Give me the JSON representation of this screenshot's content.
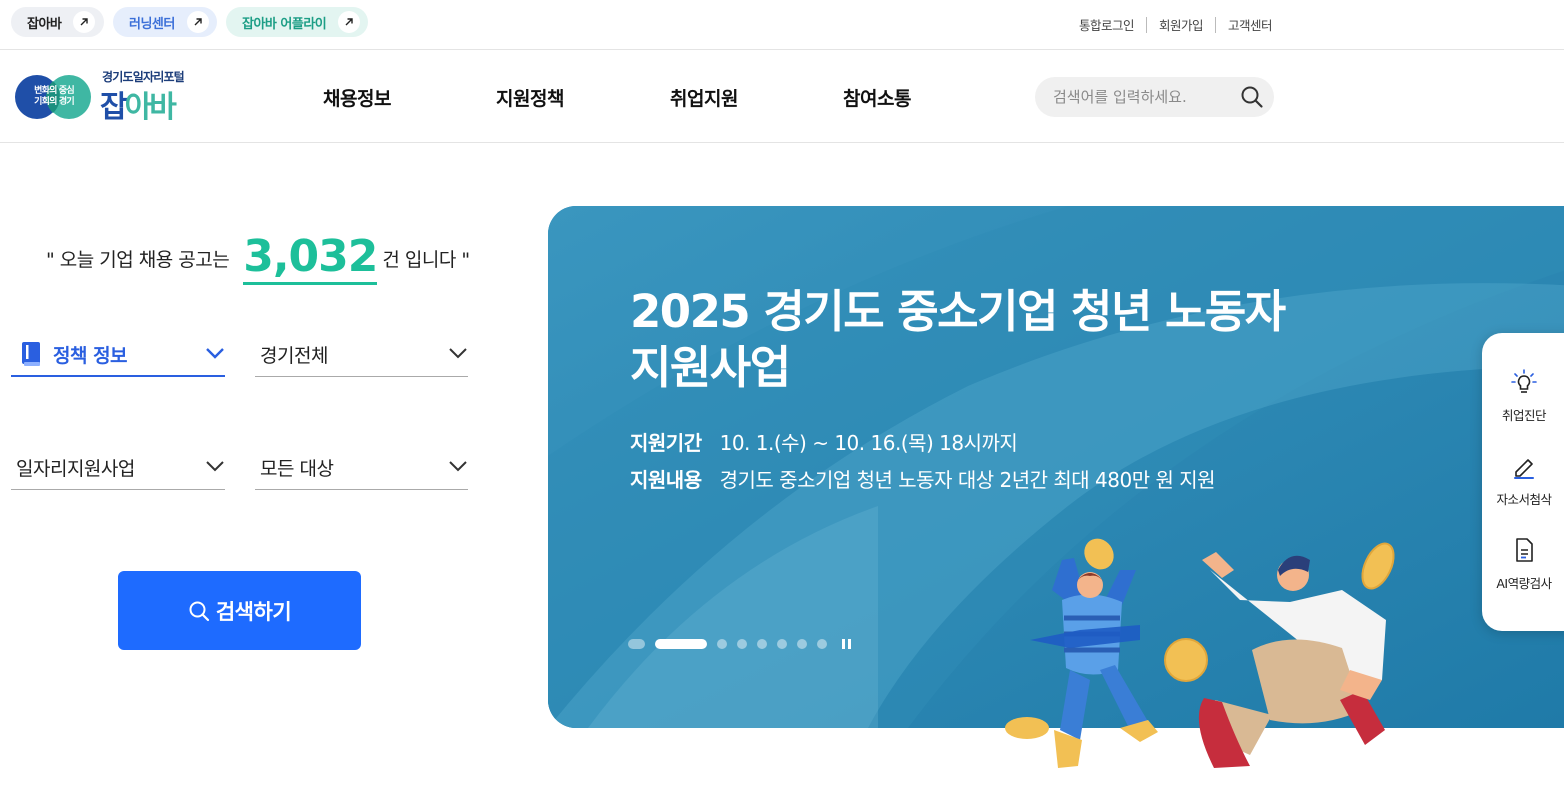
{
  "top_links": [
    {
      "label": "잡아바",
      "icon": "external-arrow-icon"
    },
    {
      "label": "러닝센터",
      "icon": "external-arrow-icon"
    },
    {
      "label": "잡아바 어플라이",
      "icon": "external-arrow-icon"
    }
  ],
  "util_menu": [
    "통합로그인",
    "회원가입",
    "고객센터"
  ],
  "logo": {
    "circle_line1": "변화의 중심",
    "circle_line2": "기회의 경기",
    "subtitle": "경기도일자리포털",
    "main_a": "잡",
    "main_b": "아바"
  },
  "gnb": [
    "채용정보",
    "지원정책",
    "취업지원",
    "참여소통"
  ],
  "search": {
    "placeholder": "검색어를 입력하세요.",
    "icon": "search-icon"
  },
  "today": {
    "prefix": "\" 오늘 기업 채용 공고는",
    "count": "3,032",
    "suffix": "건 입니다 \""
  },
  "filters": {
    "category": "정책 정보",
    "region": "경기전체",
    "program": "일자리지원사업",
    "target": "모든 대상"
  },
  "search_button": "검색하기",
  "banner": {
    "title_line1": "2025 경기도 중소기업 청년 노동자",
    "title_line2": "지원사업",
    "period_label": "지원기간",
    "period_value": "10. 1.(수) ~ 10. 16.(목) 18시까지",
    "content_label": "지원내용",
    "content_value": "경기도 중소기업 청년 노동자 대상 2년간 최대 480만 원 지원",
    "slide_count": 8,
    "active_slide": 2
  },
  "quick_menu": [
    {
      "label": "취업진단",
      "icon": "lightbulb-icon"
    },
    {
      "label": "자소서첨삭",
      "icon": "pencil-icon"
    },
    {
      "label": "AI역량검사",
      "icon": "document-icon"
    }
  ],
  "colors": {
    "accent": "#1e6bff",
    "count": "#1dbf9a",
    "banner": "#2b86b1"
  }
}
